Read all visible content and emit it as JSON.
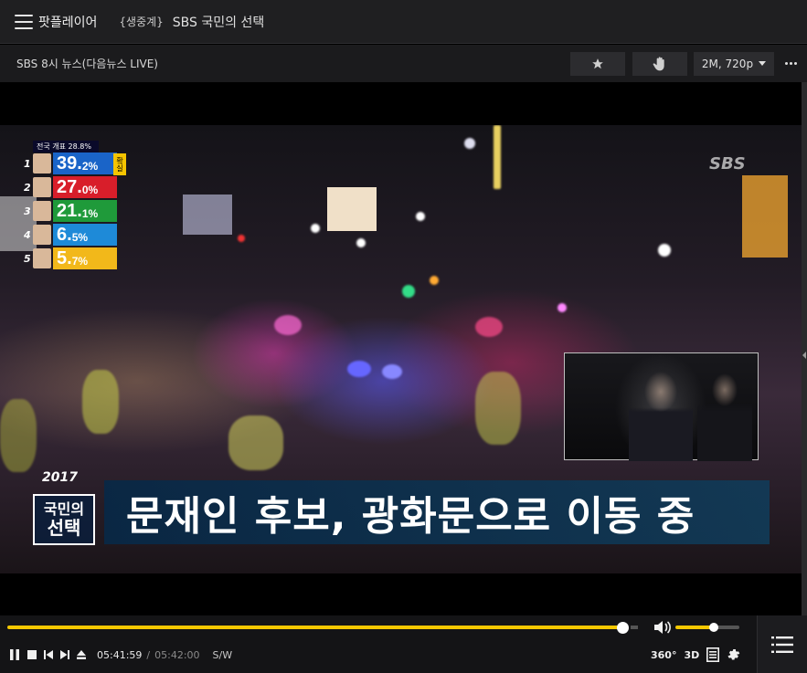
{
  "titlebar": {
    "app_name": "팟플레이어",
    "live_tag": "{생중계}",
    "window_title": "SBS 국민의 선택"
  },
  "infobar": {
    "channel_title": "SBS 8시 뉴스(다음뉴스 LIVE)",
    "quality_label": "2M, 720p",
    "icons": [
      "star-icon",
      "hand-icon",
      "chevron-down-icon",
      "more-icon"
    ]
  },
  "video": {
    "broadcaster_logo": "SBS",
    "poll": {
      "header": "전국 개표 28.8%",
      "rows": [
        {
          "rank": "1",
          "value": "39.",
          "decimal": "2%",
          "color": "#1a64c8"
        },
        {
          "rank": "2",
          "value": "27.",
          "decimal": "0%",
          "color": "#d81e2a"
        },
        {
          "rank": "3",
          "value": "21.",
          "decimal": "1%",
          "color": "#1f9a3a"
        },
        {
          "rank": "4",
          "value": "6.",
          "decimal": "5%",
          "color": "#1e8ad8"
        },
        {
          "rank": "5",
          "value": "5.",
          "decimal": "7%",
          "color": "#f2b81a"
        }
      ],
      "badge": "확실"
    },
    "caption": {
      "year": "2017",
      "logo_line1": "국민의",
      "logo_line2": "선택",
      "text": "문재인 후보, 광화문으로 이동 중"
    }
  },
  "controls": {
    "seek_progress": 0.985,
    "volume_level": 0.6,
    "time_current": "05:41:59",
    "time_separator": "/",
    "time_total": "05:42:00",
    "sw_label": "S/W",
    "btn_360": "360°",
    "btn_3d": "3D",
    "accent_color": "#f5c800",
    "icons": [
      "pause-icon",
      "stop-icon",
      "previous-icon",
      "next-icon",
      "eject-icon",
      "volume-icon",
      "subtitle-icon",
      "settings-icon",
      "playlist-icon"
    ]
  }
}
